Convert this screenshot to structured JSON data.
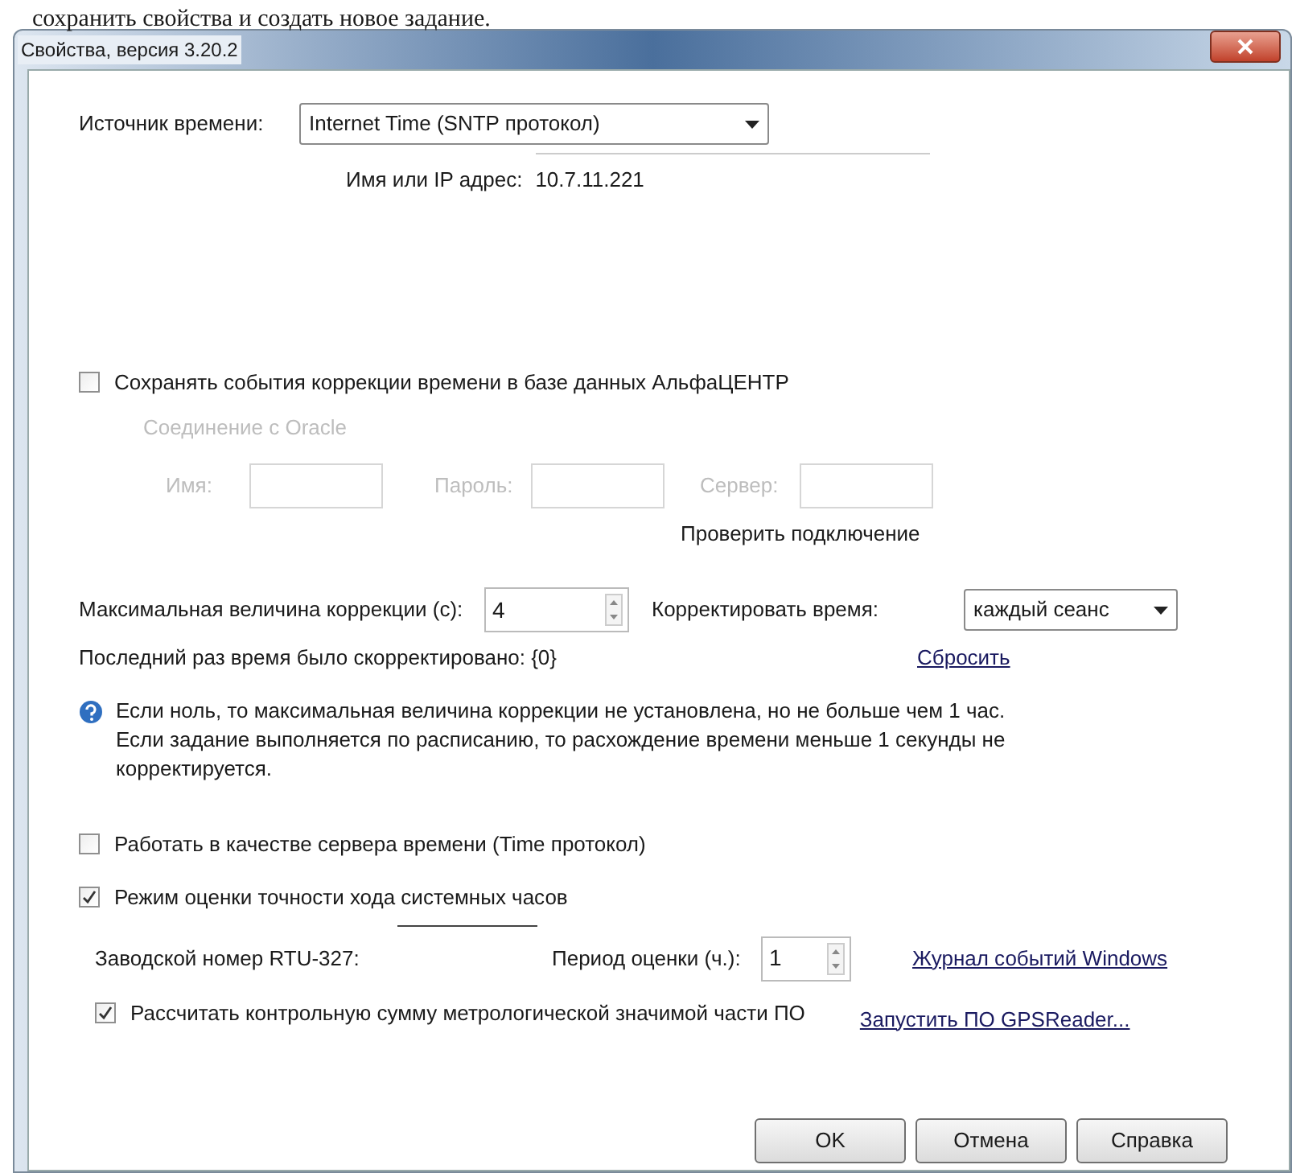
{
  "page_text": "сохранить свойства и создать новое задание.",
  "window": {
    "title": "Свойства, версия 3.20.2"
  },
  "time_source": {
    "label": "Источник времени:",
    "value": "Internet Time (SNTP протокол)"
  },
  "address": {
    "label": "Имя или IP адрес:",
    "value": "10.7.11.221"
  },
  "save_events": {
    "label": "Сохранять события коррекции времени  в базе данных АльфаЦЕНТР",
    "checked": false
  },
  "oracle": {
    "title": "Соединение с Oracle",
    "disabled": true,
    "fields": [
      {
        "label": "Имя:"
      },
      {
        "label": "Пароль:"
      },
      {
        "label": "Сервер:"
      }
    ],
    "test_link": "Проверить подключение"
  },
  "max_correction": {
    "label": "Максимальная величина коррекции (с):",
    "value": "4"
  },
  "correct_time": {
    "label": "Корректировать время:",
    "value": "каждый сеанс"
  },
  "last_corrected": "Последний раз время было скорректировано: {0}",
  "reset_link": "Сбросить",
  "info_lines": [
    "Если ноль, то максимальная величина коррекции не установлена, но не больше чем 1 час.",
    "Если задание выполняется по расписанию, то расхождение времени меньше 1 секунды не корректируется."
  ],
  "time_server": {
    "label": "Работать в качестве сервера времени (Time протокол)",
    "checked": false
  },
  "accuracy_mode": {
    "label": "Режим оценки точности хода системных часов",
    "checked": true
  },
  "serial": {
    "label": "Заводской номер RTU-327:"
  },
  "period": {
    "label": "Период оценки (ч.):",
    "value": "1"
  },
  "events_link": "Журнал событий Windows",
  "checksum": {
    "label": "Рассчитать контрольную сумму метрологической значимой части ПО",
    "checked": true
  },
  "gps_link": "Запустить ПО GPSReader...",
  "buttons": [
    "OK",
    "Отмена",
    "Справка"
  ]
}
